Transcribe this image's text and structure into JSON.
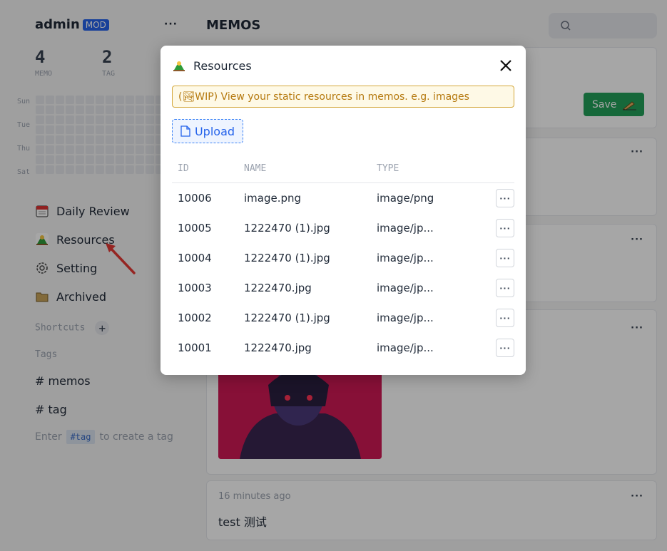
{
  "sidebar": {
    "username": "admin",
    "badge": "MOD",
    "more": "···",
    "stats": [
      {
        "num": "4",
        "label": "MEMO"
      },
      {
        "num": "2",
        "label": "TAG"
      }
    ],
    "heatmap_days": [
      "Sun",
      "Tue",
      "Thu",
      "Sat"
    ],
    "nav": [
      {
        "label": "Daily Review",
        "icon": "calendar-icon"
      },
      {
        "label": "Resources",
        "icon": "resources-icon"
      },
      {
        "label": "Setting",
        "icon": "gear-icon"
      },
      {
        "label": "Archived",
        "icon": "folder-icon"
      }
    ],
    "shortcuts_title": "Shortcuts",
    "tags_title": "Tags",
    "tags": [
      "# memos",
      "# tag"
    ],
    "tag_hint_prefix": "Enter",
    "tag_hint_code": "#tag",
    "tag_hint_suffix": "to create a tag"
  },
  "main": {
    "title": "MEMOS",
    "save_label": "Save",
    "memo_time": "16 minutes ago",
    "memo_text": "test 测试",
    "accent": "#22a05a"
  },
  "dialog": {
    "title": "Resources",
    "info": "(🏞WIP) View your static resources in memos. e.g. images",
    "upload_label": "Upload",
    "columns": {
      "id": "ID",
      "name": "NAME",
      "type": "TYPE"
    },
    "rows": [
      {
        "id": "10006",
        "name": "image.png",
        "type": "image/png"
      },
      {
        "id": "10005",
        "name": "1222470 (1).jpg",
        "type": "image/jp..."
      },
      {
        "id": "10004",
        "name": "1222470 (1).jpg",
        "type": "image/jp..."
      },
      {
        "id": "10003",
        "name": "1222470.jpg",
        "type": "image/jp..."
      },
      {
        "id": "10002",
        "name": "1222470 (1).jpg",
        "type": "image/jp..."
      },
      {
        "id": "10001",
        "name": "1222470.jpg",
        "type": "image/jp..."
      }
    ],
    "row_action": "···"
  }
}
